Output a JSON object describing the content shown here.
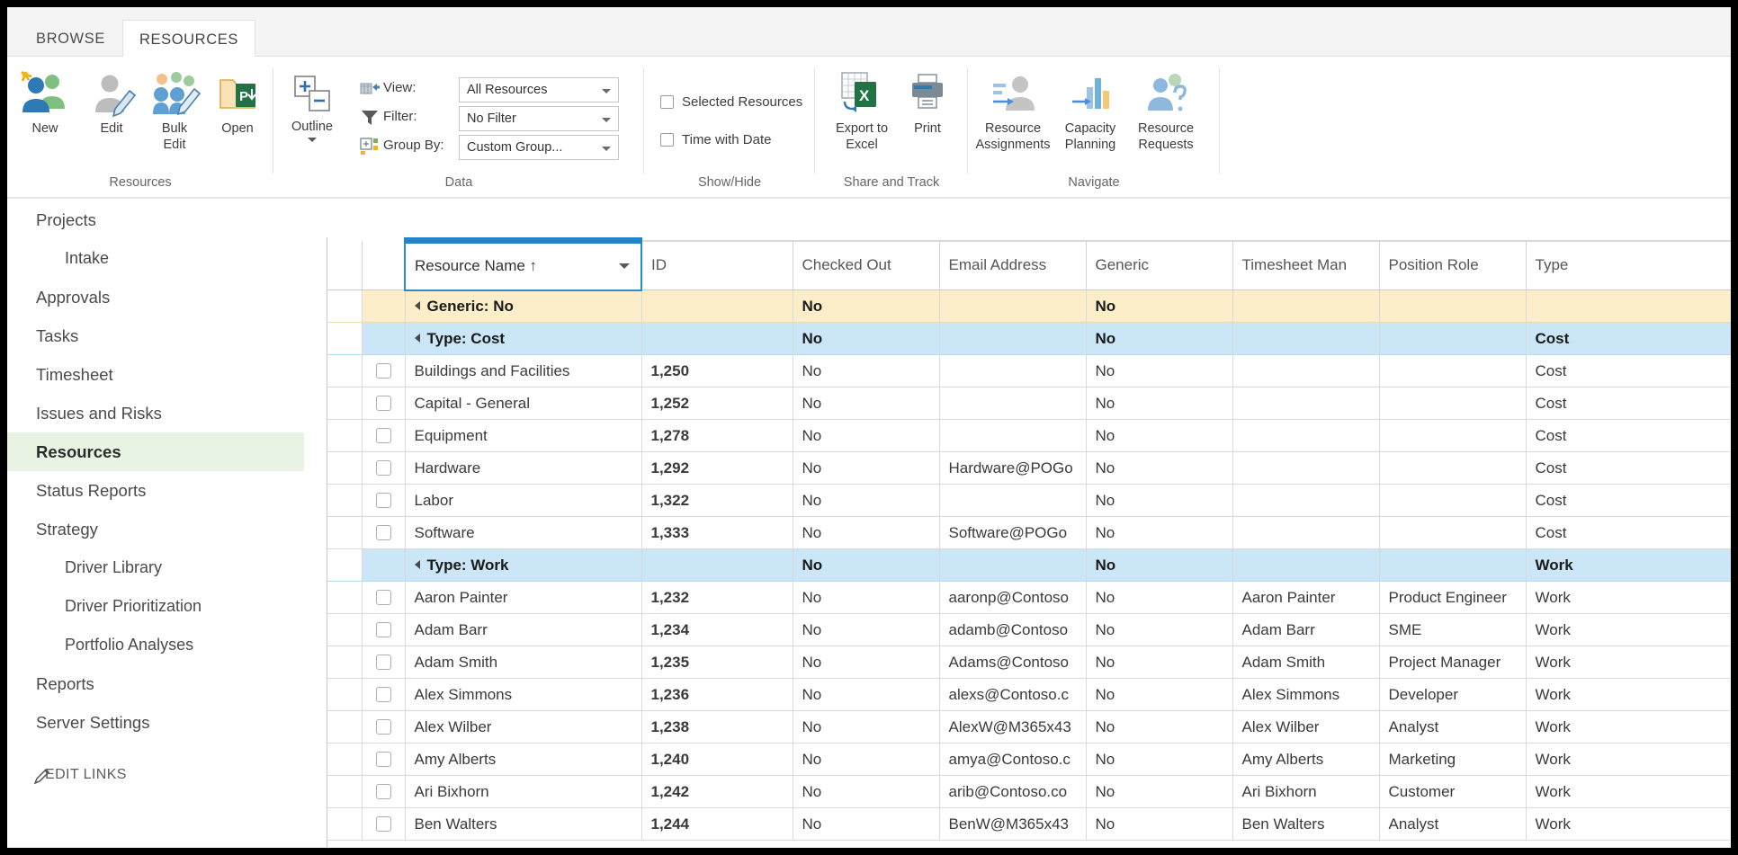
{
  "ribbon": {
    "tabs": [
      {
        "label": "BROWSE",
        "name": "tab-browse",
        "selected": false
      },
      {
        "label": "RESOURCES",
        "name": "tab-resources",
        "selected": true
      }
    ],
    "groups": [
      {
        "label": "Resources"
      },
      {
        "label": "Data"
      },
      {
        "label": "Show/Hide"
      },
      {
        "label": "Share and Track"
      },
      {
        "label": "Navigate"
      }
    ],
    "buttons": {
      "new": "New",
      "edit": "Edit",
      "bulk_edit": "Bulk\nEdit",
      "bulk_edit_l1": "Bulk",
      "bulk_edit_l2": "Edit",
      "open": "Open",
      "outline": "Outline",
      "export_l1": "Export to",
      "export_l2": "Excel",
      "print": "Print",
      "res_assign_l1": "Resource",
      "res_assign_l2": "Assignments",
      "cap_plan_l1": "Capacity",
      "cap_plan_l2": "Planning",
      "res_req_l1": "Resource",
      "res_req_l2": "Requests"
    },
    "data": {
      "view_label": "View:",
      "view_value": "All Resources",
      "filter_label": "Filter:",
      "filter_value": "No Filter",
      "groupby_label": "Group By:",
      "groupby_value": "Custom Group..."
    },
    "showhide": {
      "selected_resources": "Selected Resources",
      "time_with_date": "Time with Date"
    }
  },
  "sidebar": {
    "items": [
      {
        "label": "Projects",
        "sub": false,
        "selected": false
      },
      {
        "label": "Intake",
        "sub": true,
        "selected": false
      },
      {
        "label": "Approvals",
        "sub": false,
        "selected": false
      },
      {
        "label": "Tasks",
        "sub": false,
        "selected": false
      },
      {
        "label": "Timesheet",
        "sub": false,
        "selected": false
      },
      {
        "label": "Issues and Risks",
        "sub": false,
        "selected": false
      },
      {
        "label": "Resources",
        "sub": false,
        "selected": true
      },
      {
        "label": "Status Reports",
        "sub": false,
        "selected": false
      },
      {
        "label": "Strategy",
        "sub": false,
        "selected": false
      },
      {
        "label": "Driver Library",
        "sub": true,
        "selected": false
      },
      {
        "label": "Driver Prioritization",
        "sub": true,
        "selected": false
      },
      {
        "label": "Portfolio Analyses",
        "sub": true,
        "selected": false
      },
      {
        "label": "Reports",
        "sub": false,
        "selected": false
      },
      {
        "label": "Server Settings",
        "sub": false,
        "selected": false
      }
    ],
    "edit_links": "EDIT LINKS"
  },
  "grid": {
    "sort_indicator": "↑",
    "columns": [
      {
        "key": "sel",
        "label": "",
        "sorted": false
      },
      {
        "key": "chk",
        "label": "",
        "sorted": false
      },
      {
        "key": "name",
        "label": "Resource Name ↑",
        "sorted": true
      },
      {
        "key": "id",
        "label": "ID",
        "sorted": false
      },
      {
        "key": "co",
        "label": "Checked Out",
        "sorted": false
      },
      {
        "key": "em",
        "label": "Email Address",
        "sorted": false
      },
      {
        "key": "gen",
        "label": "Generic",
        "sorted": false
      },
      {
        "key": "ts",
        "label": "Timesheet Man",
        "sorted": false
      },
      {
        "key": "pr",
        "label": "Position Role",
        "sorted": false
      },
      {
        "key": "ty",
        "label": "Type",
        "sorted": false
      }
    ],
    "rows": [
      {
        "kind": "group1",
        "name": "Generic: No",
        "id": "",
        "co": "No",
        "em": "",
        "gen": "No",
        "ts": "",
        "pr": "",
        "ty": ""
      },
      {
        "kind": "group2",
        "name": "Type: Cost",
        "id": "",
        "co": "No",
        "em": "",
        "gen": "No",
        "ts": "",
        "pr": "",
        "ty": "Cost"
      },
      {
        "kind": "leaf",
        "name": "Buildings and Facilities",
        "id": "1,250",
        "co": "No",
        "em": "",
        "gen": "No",
        "ts": "",
        "pr": "",
        "ty": "Cost"
      },
      {
        "kind": "leaf",
        "name": "Capital - General",
        "id": "1,252",
        "co": "No",
        "em": "",
        "gen": "No",
        "ts": "",
        "pr": "",
        "ty": "Cost"
      },
      {
        "kind": "leaf",
        "name": "Equipment",
        "id": "1,278",
        "co": "No",
        "em": "",
        "gen": "No",
        "ts": "",
        "pr": "",
        "ty": "Cost"
      },
      {
        "kind": "leaf",
        "name": "Hardware",
        "id": "1,292",
        "co": "No",
        "em": "Hardware@POGo",
        "gen": "No",
        "ts": "",
        "pr": "",
        "ty": "Cost"
      },
      {
        "kind": "leaf",
        "name": "Labor",
        "id": "1,322",
        "co": "No",
        "em": "",
        "gen": "No",
        "ts": "",
        "pr": "",
        "ty": "Cost"
      },
      {
        "kind": "leaf",
        "name": "Software",
        "id": "1,333",
        "co": "No",
        "em": "Software@POGo",
        "gen": "No",
        "ts": "",
        "pr": "",
        "ty": "Cost"
      },
      {
        "kind": "group2",
        "name": "Type: Work",
        "id": "",
        "co": "No",
        "em": "",
        "gen": "No",
        "ts": "",
        "pr": "",
        "ty": "Work"
      },
      {
        "kind": "leaf",
        "name": "Aaron Painter",
        "id": "1,232",
        "co": "No",
        "em": "aaronp@Contoso",
        "gen": "No",
        "ts": "Aaron Painter",
        "pr": "Product Engineer",
        "ty": "Work"
      },
      {
        "kind": "leaf",
        "name": "Adam Barr",
        "id": "1,234",
        "co": "No",
        "em": "adamb@Contoso",
        "gen": "No",
        "ts": "Adam Barr",
        "pr": "SME",
        "ty": "Work"
      },
      {
        "kind": "leaf",
        "name": "Adam Smith",
        "id": "1,235",
        "co": "No",
        "em": "Adams@Contoso",
        "gen": "No",
        "ts": "Adam Smith",
        "pr": "Project Manager",
        "ty": "Work"
      },
      {
        "kind": "leaf",
        "name": "Alex Simmons",
        "id": "1,236",
        "co": "No",
        "em": "alexs@Contoso.c",
        "gen": "No",
        "ts": "Alex Simmons",
        "pr": "Developer",
        "ty": "Work"
      },
      {
        "kind": "leaf",
        "name": "Alex Wilber",
        "id": "1,238",
        "co": "No",
        "em": "AlexW@M365x43",
        "gen": "No",
        "ts": "Alex Wilber",
        "pr": "Analyst",
        "ty": "Work"
      },
      {
        "kind": "leaf",
        "name": "Amy Alberts",
        "id": "1,240",
        "co": "No",
        "em": "amya@Contoso.c",
        "gen": "No",
        "ts": "Amy Alberts",
        "pr": "Marketing",
        "ty": "Work"
      },
      {
        "kind": "leaf",
        "name": "Ari Bixhorn",
        "id": "1,242",
        "co": "No",
        "em": "arib@Contoso.co",
        "gen": "No",
        "ts": "Ari Bixhorn",
        "pr": "Customer",
        "ty": "Work"
      },
      {
        "kind": "leaf",
        "name": "Ben Walters",
        "id": "1,244",
        "co": "No",
        "em": "BenW@M365x43",
        "gen": "No",
        "ts": "Ben Walters",
        "pr": "Analyst",
        "ty": "Work"
      }
    ]
  },
  "colors": {
    "group_level1_bg": "#fbeec8",
    "group_level2_bg": "#cbe7f7",
    "selected_nav_bg": "#e8f3e4",
    "sort_header_border": "#1f84c8"
  }
}
